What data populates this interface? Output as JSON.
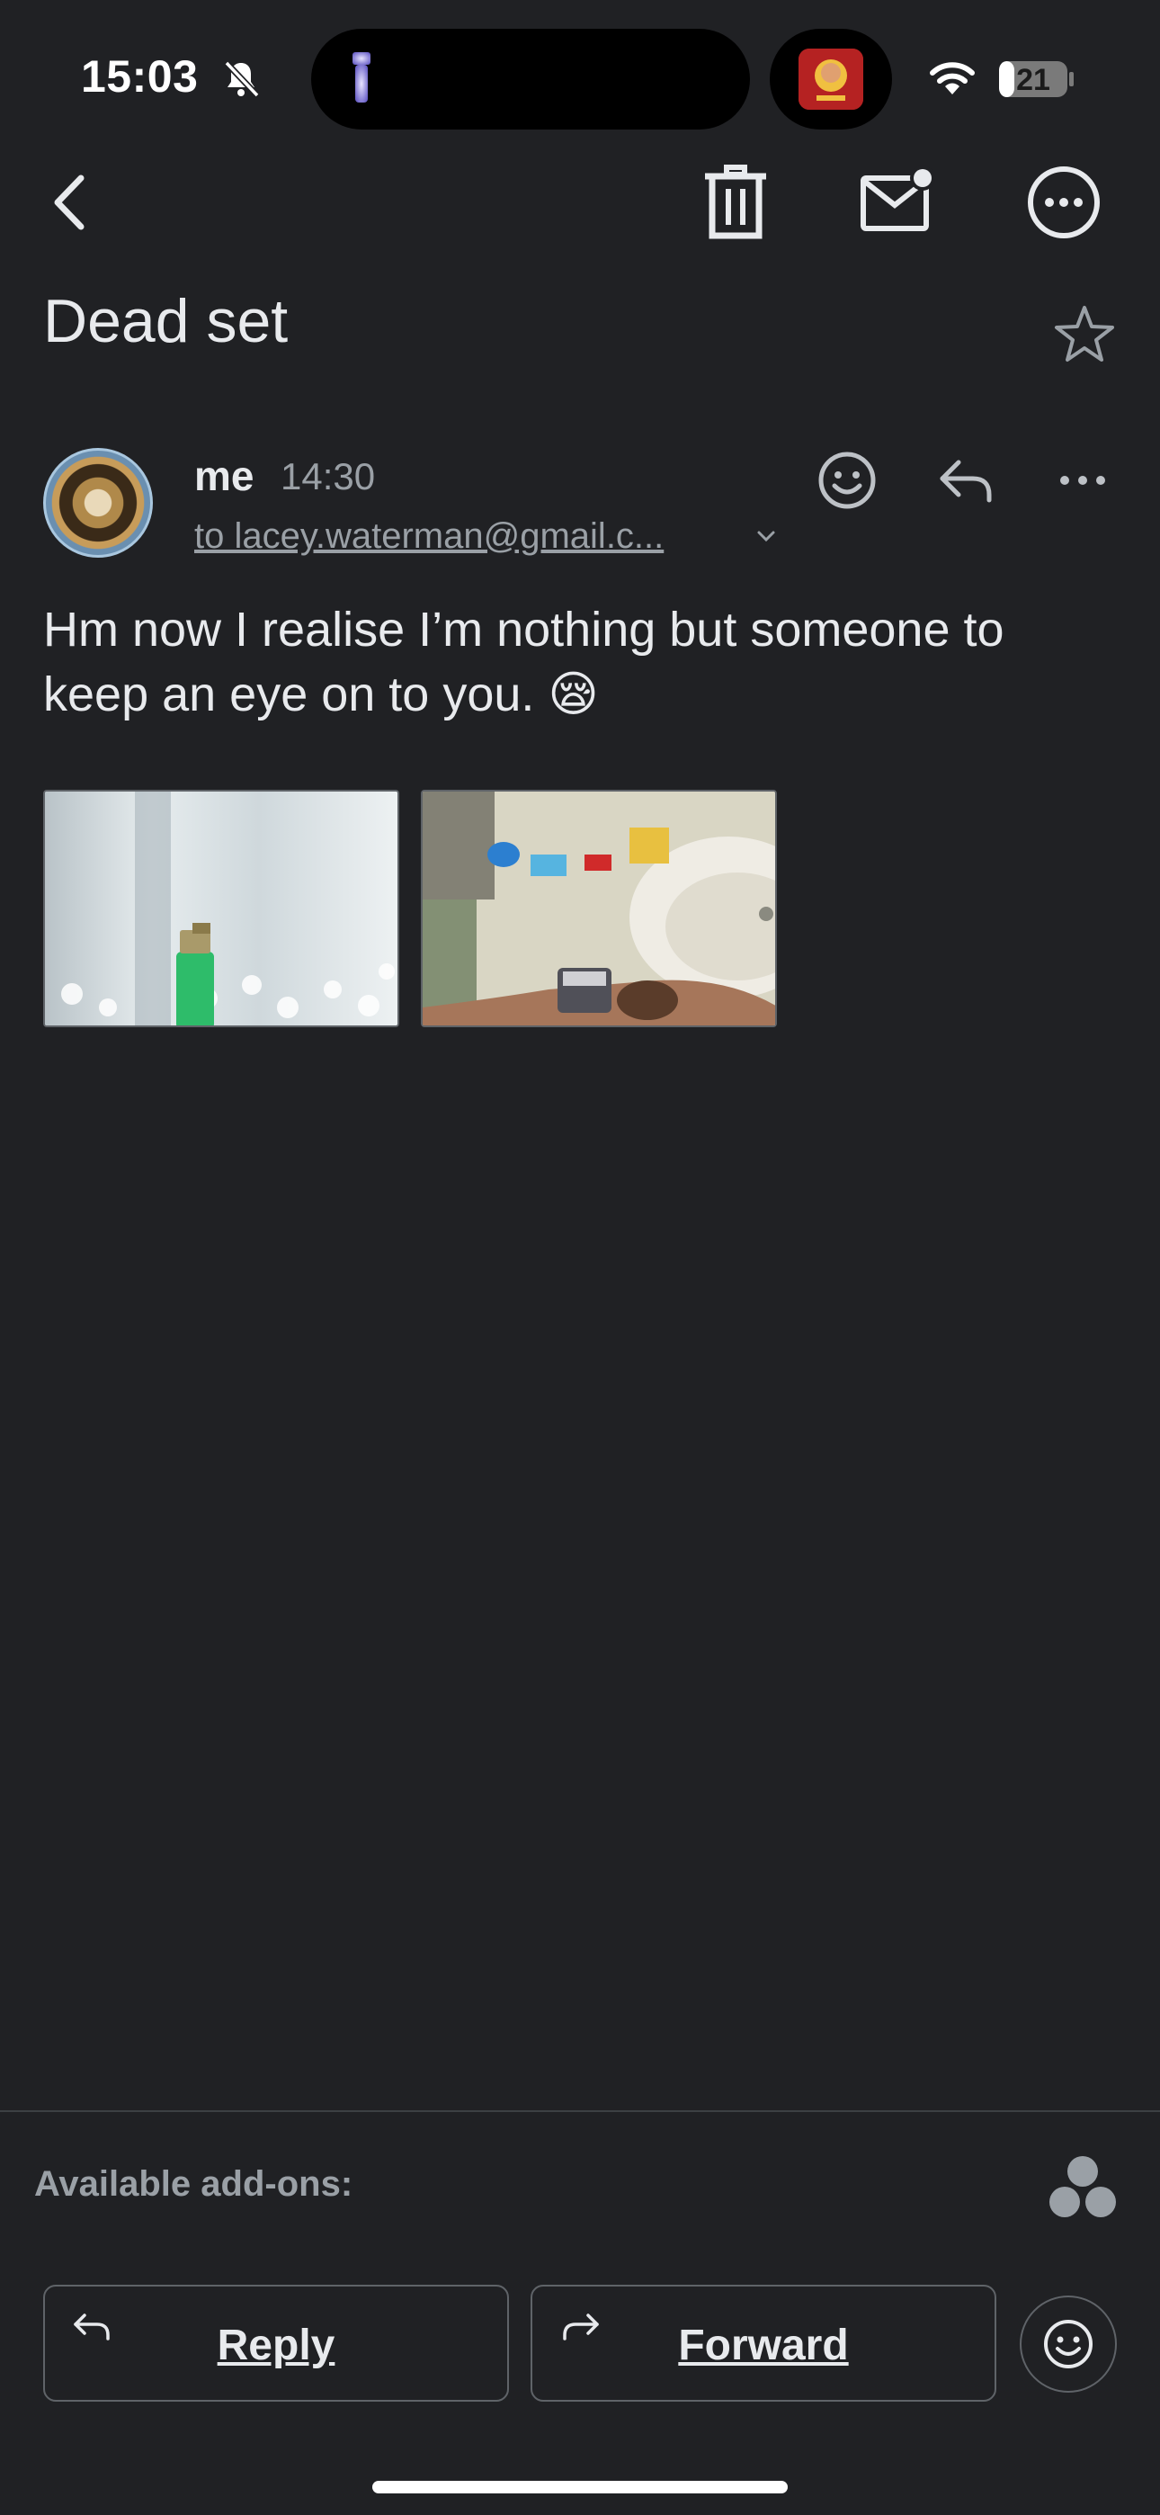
{
  "status_bar": {
    "time": "15:03",
    "battery": "21",
    "icons": [
      "bell-off-icon",
      "flashlight-icon",
      "app-avatar-icon",
      "wifi-icon",
      "battery-icon"
    ]
  },
  "toolbar": {
    "icons": [
      "back-icon",
      "trash-icon",
      "mark-unread-icon",
      "more-options-icon"
    ]
  },
  "subject": "Dead set",
  "message": {
    "sender": "me",
    "time": "14:30",
    "recipient": "to lacey.waterman@gmail.c...",
    "body": "Hm now I realise I’m nothing but someone to keep an eye on to you. 😪",
    "attachments": [
      "image-attachment-1",
      "image-attachment-2"
    ]
  },
  "footer": {
    "addons_label": "Available add-ons:",
    "reply_label": "Reply",
    "forward_label": "Forward"
  },
  "colors": {
    "background": "#202124",
    "text": "#e8eaed",
    "secondary_text": "#9aa0a6",
    "border": "#5f6368"
  }
}
